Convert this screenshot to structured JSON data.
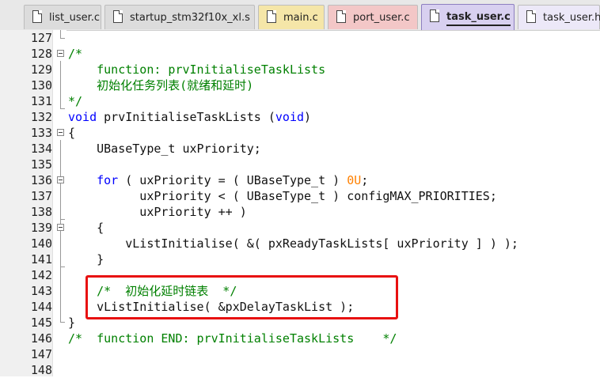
{
  "tabs": [
    {
      "label": "list_user.c",
      "active": false,
      "color": "#dcdcdc"
    },
    {
      "label": "startup_stm32f10x_xl.s",
      "active": false,
      "color": "#dcdcdc"
    },
    {
      "label": "main.c",
      "active": false,
      "color": "#f5e6a8"
    },
    {
      "label": "port_user.c",
      "active": false,
      "color": "#f3c7c7"
    },
    {
      "label": "task_user.c",
      "active": true,
      "color": "#d8d0f0"
    },
    {
      "label": "task_user.h",
      "active": false,
      "color": "#ece8f8"
    }
  ],
  "editor": {
    "lines": [
      {
        "num": "127",
        "text": ""
      },
      {
        "num": "128",
        "text": "/*"
      },
      {
        "num": "129",
        "text": "    function: prvInitialiseTaskLists"
      },
      {
        "num": "130",
        "text": "    初始化任务列表(就绪和延时)"
      },
      {
        "num": "131",
        "text": "*/"
      },
      {
        "num": "132",
        "text": "void prvInitialiseTaskLists (void)"
      },
      {
        "num": "133",
        "text": "{"
      },
      {
        "num": "134",
        "text": "    UBaseType_t uxPriority;"
      },
      {
        "num": "135",
        "text": ""
      },
      {
        "num": "136",
        "text": "    for ( uxPriority = ( UBaseType_t ) 0U;"
      },
      {
        "num": "137",
        "text": "          uxPriority < ( UBaseType_t ) configMAX_PRIORITIES;"
      },
      {
        "num": "138",
        "text": "          uxPriority ++ )"
      },
      {
        "num": "139",
        "text": "    {"
      },
      {
        "num": "140",
        "text": "        vListInitialise( &( pxReadyTaskLists[ uxPriority ] ) );"
      },
      {
        "num": "141",
        "text": "    }"
      },
      {
        "num": "142",
        "text": ""
      },
      {
        "num": "143",
        "text": "    /*  初始化延时链表  */"
      },
      {
        "num": "144",
        "text": "    vListInitialise( &pxDelayTaskList );"
      },
      {
        "num": "145",
        "text": "}"
      },
      {
        "num": "146",
        "text": "/*  function END: prvInitialiseTaskLists    */"
      },
      {
        "num": "147",
        "text": ""
      },
      {
        "num": "148",
        "text": ""
      }
    ]
  },
  "colors": {
    "comment": "#008000",
    "keyword": "#0000ff",
    "number": "#ff8000",
    "highlight_border": "#e81010"
  }
}
